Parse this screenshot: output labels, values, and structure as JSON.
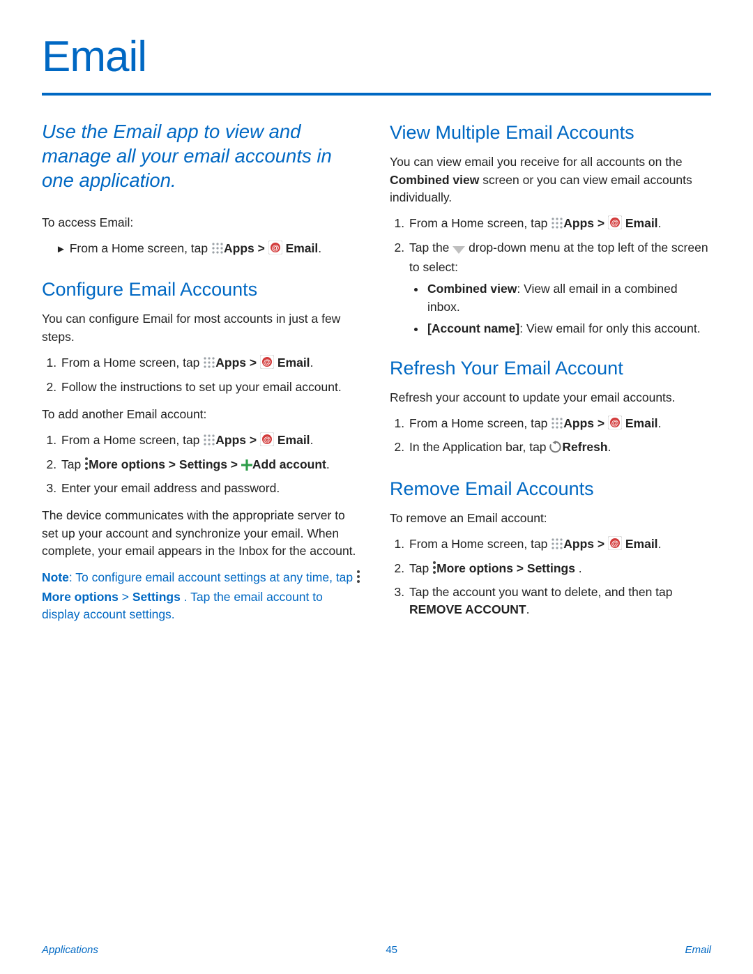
{
  "title": "Email",
  "intro": "Use the Email app to view and manage all your email accounts in one application.",
  "left": {
    "access_label": "To access Email:",
    "access_step_prefix": " From a Home screen, tap ",
    "apps": "Apps",
    "gt": " > ",
    "email": "Email",
    "configure": {
      "heading": "Configure Email Accounts",
      "intro": "You can configure Email for most accounts in just a few steps.",
      "step1_prefix": "From a Home screen, tap ",
      "step2": "Follow the instructions to set up your email account.",
      "add_label": "To add another Email account:",
      "add_step1_prefix": "From a Home screen, tap ",
      "add_step2_tap": "Tap ",
      "more_options": "More options",
      "gt2": " > ",
      "settings": "Settings",
      "gt3": "  > ",
      "add_account": "Add account",
      "add_step3": "Enter your email address and password.",
      "outro": "The device communicates with the appropriate server to set up your account and synchronize your email. When complete, your email appears in the Inbox for the account.",
      "note_label": "Note",
      "note_text1": ": To configure email account settings at any time, tap ",
      "note_mo": "More options",
      "note_gt": " > ",
      "note_settings": "Settings",
      "note_text2": " . Tap the email account to display account settings."
    }
  },
  "right": {
    "view": {
      "heading": "View Multiple Email Accounts",
      "intro_a": "You can view email you receive for all accounts on the ",
      "intro_b": "Combined view",
      "intro_c": " screen or you can view email accounts individually.",
      "step1_prefix": "From a Home screen, tap ",
      "apps": "Apps",
      "gt": " > ",
      "email": "Email",
      "step2a": "Tap the ",
      "step2b": " drop-down menu at the top left of the screen to select:",
      "b1_label": "Combined view",
      "b1_text": ": View all email in a combined inbox.",
      "b2_label": "[Account name]",
      "b2_text": ": View email for only this account."
    },
    "refresh": {
      "heading": "Refresh Your Email Account",
      "intro": "Refresh your account to update your email accounts.",
      "step1_prefix": "From a Home screen, tap ",
      "apps": "Apps",
      "gt": " > ",
      "email": "Email",
      "step2a": "In the Application bar, tap ",
      "refresh": "Refresh"
    },
    "remove": {
      "heading": "Remove Email Accounts",
      "intro": "To remove an Email account:",
      "step1_prefix": "From a Home screen, tap ",
      "apps": "Apps",
      "gt": " > ",
      "email": "Email",
      "step2_tap": "Tap ",
      "more_options": "More options",
      "gt2": " > ",
      "settings": "Settings",
      "step2_dot": " .",
      "step3a": "Tap the account you want to delete, and then tap ",
      "remove_account": "REMOVE ACCOUNT",
      "step3b": "."
    }
  },
  "footer": {
    "left": "Applications",
    "page": "45",
    "right": "Email"
  }
}
